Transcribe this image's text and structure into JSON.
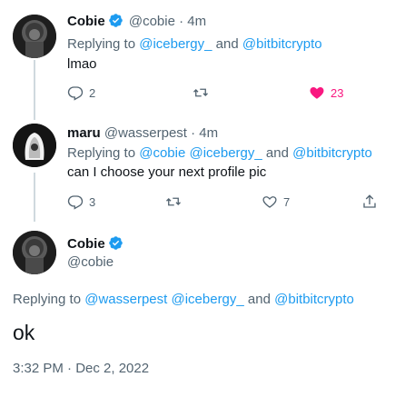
{
  "tweet1": {
    "name": "Cobie",
    "handle": "@cobie",
    "sep": "·",
    "time": "4m",
    "replying_prefix": "Replying to",
    "replying_1": "@icebergy_",
    "replying_and": "and",
    "replying_2": "@bitbitcrypto",
    "text": "lmao",
    "reply_count": "2",
    "like_count": "23"
  },
  "tweet2": {
    "name": "maru",
    "handle": "@wasserpest",
    "sep": "·",
    "time": "4m",
    "replying_prefix": "Replying to",
    "replying_1": "@cobie @icebergy_",
    "replying_and": "and",
    "replying_2": "@bitbitcrypto",
    "text": "can I choose your next profile pic",
    "reply_count": "3",
    "like_count": "7"
  },
  "main": {
    "name": "Cobie",
    "handle": "@cobie",
    "replying_prefix": "Replying to",
    "replying_1": "@wasserpest @icebergy_",
    "replying_and": "and",
    "replying_2": "@bitbitcrypto",
    "text": "ok",
    "timestamp": "3:32 PM · Dec 2, 2022"
  },
  "colors": {
    "link": "#1d9bf0",
    "like_active": "#f91880",
    "secondary_text": "#536471"
  }
}
